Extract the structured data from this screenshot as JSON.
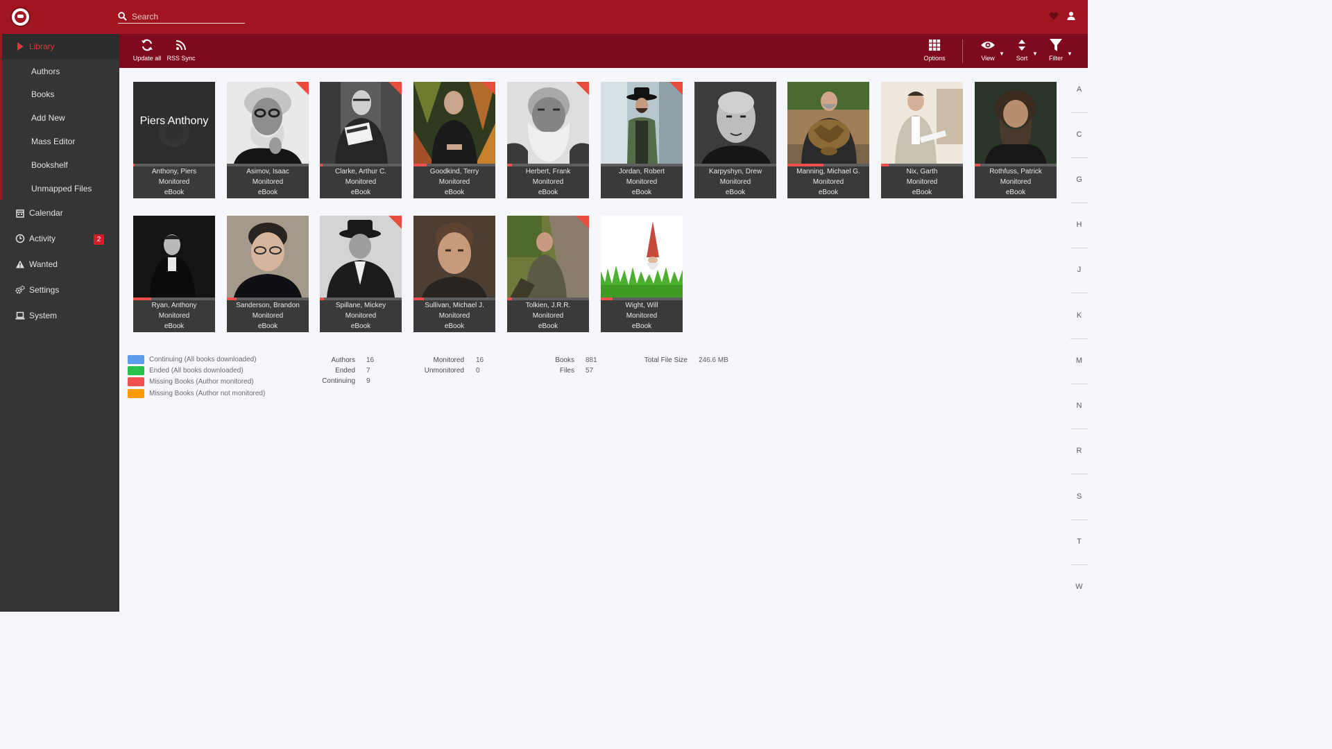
{
  "search": {
    "placeholder": "Search"
  },
  "sidebar": {
    "library": "Library",
    "sub_items": [
      "Authors",
      "Books",
      "Add New",
      "Mass Editor",
      "Bookshelf",
      "Unmapped Files"
    ],
    "calendar": "Calendar",
    "activity": "Activity",
    "activity_badge": "2",
    "wanted": "Wanted",
    "settings": "Settings",
    "system": "System"
  },
  "toolbar": {
    "update_all": "Update all",
    "rss_sync": "RSS Sync",
    "options": "Options",
    "view": "View",
    "sort": "Sort",
    "filter": "Filter"
  },
  "placeholder_author": "Piers Anthony",
  "authors": [
    {
      "name": "Anthony, Piers",
      "status": "Monitored",
      "format": "eBook",
      "progress": 0.02,
      "missing_corner": false
    },
    {
      "name": "Asimov, Isaac",
      "status": "Monitored",
      "format": "eBook",
      "progress": 0.0,
      "missing_corner": true
    },
    {
      "name": "Clarke, Arthur C.",
      "status": "Monitored",
      "format": "eBook",
      "progress": 0.03,
      "missing_corner": true
    },
    {
      "name": "Goodkind, Terry",
      "status": "Monitored",
      "format": "eBook",
      "progress": 0.16,
      "missing_corner": true
    },
    {
      "name": "Herbert, Frank",
      "status": "Monitored",
      "format": "eBook",
      "progress": 0.06,
      "missing_corner": true
    },
    {
      "name": "Jordan, Robert",
      "status": "Monitored",
      "format": "eBook",
      "progress": 0.0,
      "missing_corner": true
    },
    {
      "name": "Karpyshyn, Drew",
      "status": "Monitored",
      "format": "eBook",
      "progress": 0.0,
      "missing_corner": false
    },
    {
      "name": "Manning, Michael G.",
      "status": "Monitored",
      "format": "eBook",
      "progress": 0.44,
      "missing_corner": false
    },
    {
      "name": "Nix, Garth",
      "status": "Monitored",
      "format": "eBook",
      "progress": 0.09,
      "missing_corner": false
    },
    {
      "name": "Rothfuss, Patrick",
      "status": "Monitored",
      "format": "eBook",
      "progress": 0.07,
      "missing_corner": false
    },
    {
      "name": "Ryan, Anthony",
      "status": "Monitored",
      "format": "eBook",
      "progress": 0.22,
      "missing_corner": false
    },
    {
      "name": "Sanderson, Brandon",
      "status": "Monitored",
      "format": "eBook",
      "progress": 0.12,
      "missing_corner": false
    },
    {
      "name": "Spillane, Mickey",
      "status": "Monitored",
      "format": "eBook",
      "progress": 0.05,
      "missing_corner": true
    },
    {
      "name": "Sullivan, Michael J.",
      "status": "Monitored",
      "format": "eBook",
      "progress": 0.13,
      "missing_corner": false
    },
    {
      "name": "Tolkien, J.R.R.",
      "status": "Monitored",
      "format": "eBook",
      "progress": 0.06,
      "missing_corner": true
    },
    {
      "name": "Wight, Will",
      "status": "Monitored",
      "format": "eBook",
      "progress": 0.14,
      "missing_corner": false
    }
  ],
  "legend": [
    {
      "label": "Continuing (All books downloaded)",
      "color": "#5d9cec"
    },
    {
      "label": "Ended (All books downloaded)",
      "color": "#27c24c"
    },
    {
      "label": "Missing Books (Author monitored)",
      "color": "#f05050"
    },
    {
      "label": "Missing Books (Author not monitored)",
      "color": "#ff9900"
    }
  ],
  "stats": {
    "authors_label": "Authors",
    "authors": "16",
    "ended_label": "Ended",
    "ended": "7",
    "continuing_label": "Continuing",
    "continuing": "9",
    "monitored_label": "Monitored",
    "monitored": "16",
    "unmonitored_label": "Unmonitored",
    "unmonitored": "0",
    "books_label": "Books",
    "books": "881",
    "files_label": "Files",
    "files": "57",
    "total_size_label": "Total File Size",
    "total_size": "246.6 MB"
  },
  "jump_letters": [
    "A",
    "C",
    "G",
    "H",
    "J",
    "K",
    "M",
    "N",
    "R",
    "S",
    "T",
    "W"
  ],
  "colors": {
    "header": "#a0151f",
    "toolbar": "#7f0a1e",
    "sidebar": "#353535",
    "accent": "#f05050"
  }
}
